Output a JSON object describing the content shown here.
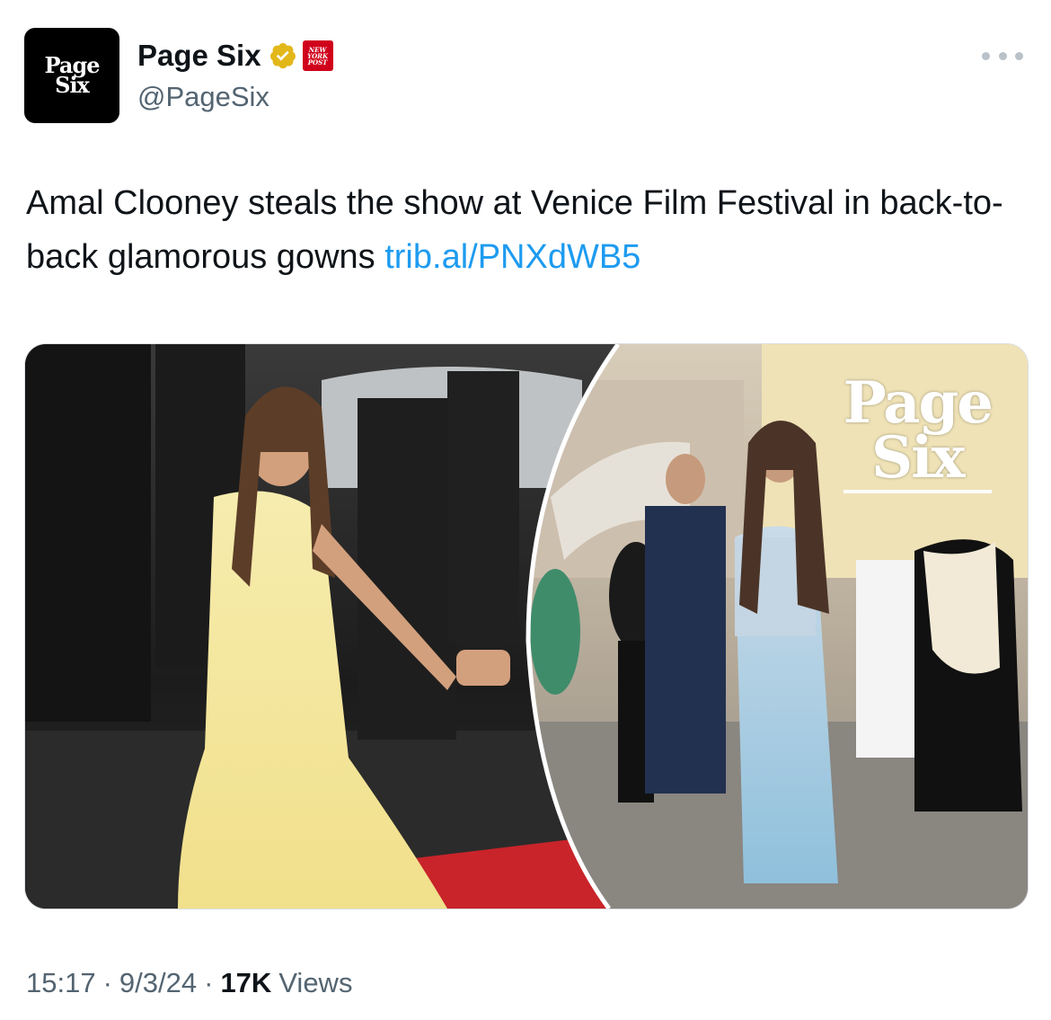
{
  "author": {
    "avatar_text_line1": "Page",
    "avatar_text_line2": "Six",
    "display_name": "Page Six",
    "handle": "@PageSix",
    "affiliate_badge_text": "NEW YORK POST"
  },
  "tweet": {
    "text": "Amal Clooney steals the show at Venice Film Festival in back-to-back glamorous gowns ",
    "link": "trib.al/PNXdWB5"
  },
  "media": {
    "watermark_line1": "Page",
    "watermark_line2": "Six"
  },
  "meta": {
    "time": "15:17",
    "date": "9/3/24",
    "views_count": "17K",
    "views_label": "Views"
  },
  "colors": {
    "link": "#1d9bf0",
    "verified_gold": "#e2b719",
    "secondary_text": "#536471"
  },
  "icons": {
    "verified": "verified-badge-icon",
    "more": "more-options-icon"
  }
}
